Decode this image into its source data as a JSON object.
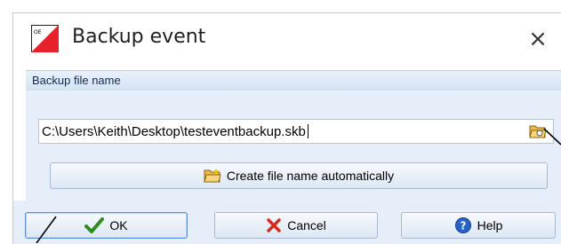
{
  "dialog": {
    "title": "Backup event",
    "close_symbol": "×",
    "app_icon": "orienteering-flag-icon"
  },
  "backup_group": {
    "title": "Backup file name",
    "path_value": "C:\\Users\\Keith\\Desktop\\testeventbackup.skb",
    "browse_icon": "folder-open-icon",
    "auto_button_label": "Create file name automatically",
    "auto_button_icon": "folder-icon"
  },
  "footer": {
    "ok_label": "OK",
    "ok_icon": "checkmark-icon",
    "cancel_label": "Cancel",
    "cancel_icon": "red-x-icon",
    "help_label": "Help",
    "help_icon": "help-question-icon"
  },
  "colors": {
    "group_header": "#d4e3f5",
    "panel_background": "#e6eef9",
    "ok_check": "#2e8b1f",
    "cancel_x": "#d62a1c",
    "help_blue": "#2563c9"
  }
}
